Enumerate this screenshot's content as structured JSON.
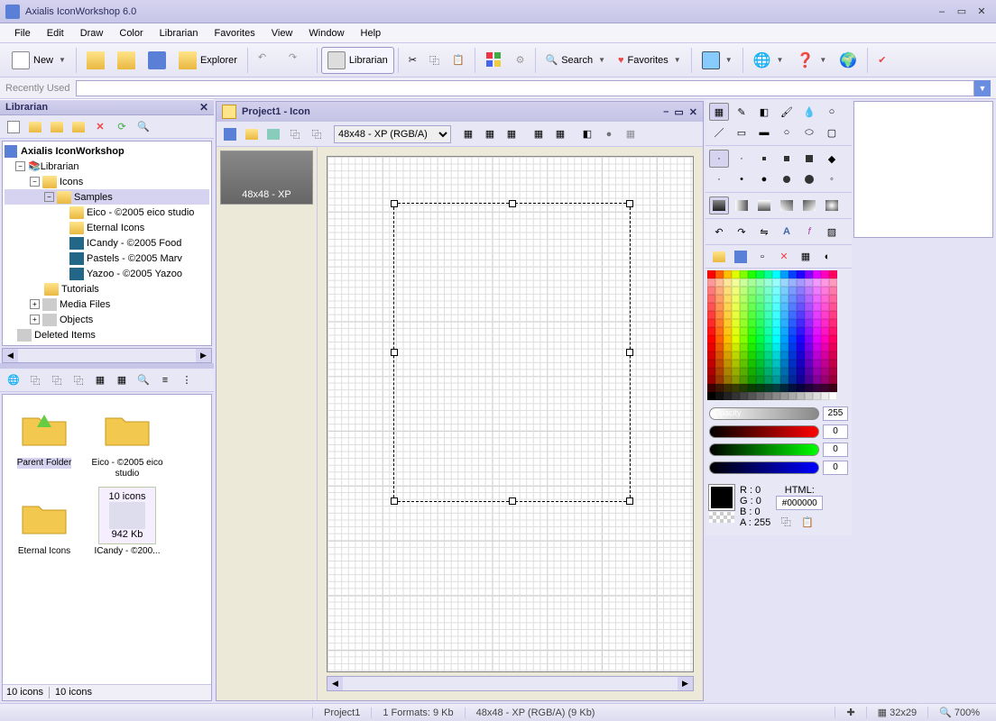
{
  "app": {
    "title": "Axialis IconWorkshop 6.0"
  },
  "menu": [
    "File",
    "Edit",
    "Draw",
    "Color",
    "Librarian",
    "Favorites",
    "View",
    "Window",
    "Help"
  ],
  "toolbar": {
    "new": "New",
    "explorer": "Explorer",
    "librarian": "Librarian",
    "search": "Search",
    "favorites": "Favorites"
  },
  "recent": {
    "label": "Recently Used"
  },
  "librarian": {
    "title": "Librarian",
    "root": "Axialis IconWorkshop",
    "tree": {
      "librarian": "Librarian",
      "icons": "Icons",
      "samples": "Samples",
      "items": [
        "Eico - ©2005 eico studio",
        "Eternal Icons",
        "ICandy - ©2005 Food",
        "Pastels - ©2005 Marv",
        "Yazoo - ©2005 Yazoo"
      ],
      "tutorials": "Tutorials",
      "media": "Media Files",
      "objects": "Objects",
      "deleted": "Deleted Items"
    },
    "thumbs": {
      "parent": "Parent Folder",
      "eico": "Eico - ©2005 eico studio",
      "eternal": "Eternal Icons",
      "icandy": "ICandy - ©200...",
      "icandy_size": "942 Kb",
      "icandy_count": "10 icons",
      "status1": "10 icons",
      "status2": "10 icons"
    }
  },
  "doc": {
    "title": "Project1 - Icon",
    "format_combo": "48x48 - XP (RGB/A)",
    "format_item": "48x48 - XP"
  },
  "color": {
    "opacity_label": "Opacity",
    "opacity": "255",
    "r": "0",
    "g": "0",
    "b": "0",
    "r_lbl": "R :",
    "g_lbl": "G :",
    "b_lbl": "B :",
    "a_lbl": "A :",
    "a_val": "255",
    "html_lbl": "HTML:",
    "html": "#000000"
  },
  "status": {
    "project": "Project1",
    "formats": "1 Formats: 9 Kb",
    "current": "48x48 - XP (RGB/A) (9 Kb)",
    "coords": "32x29",
    "zoom": "700%"
  }
}
